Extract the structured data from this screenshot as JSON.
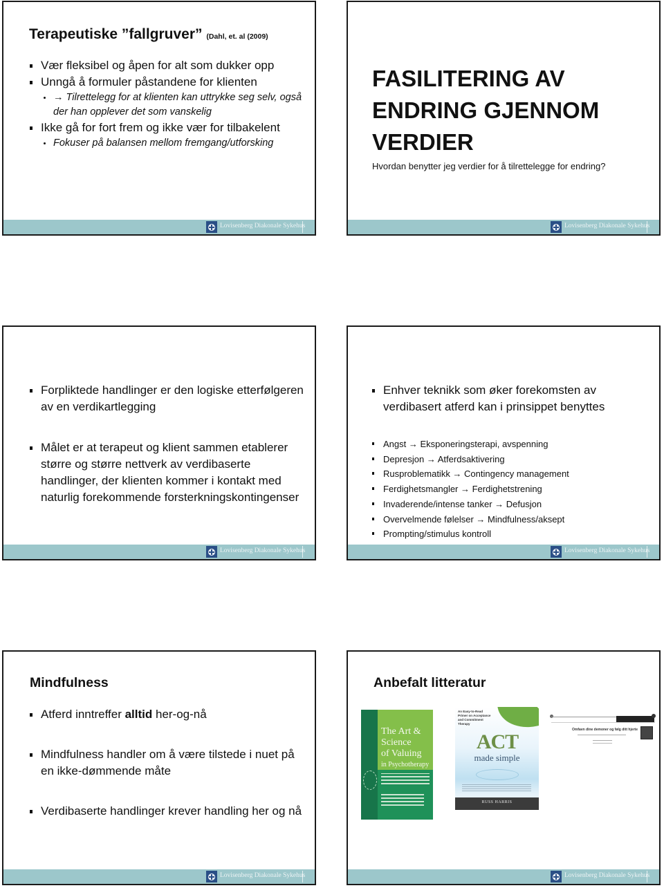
{
  "footer": {
    "org_name": "Lovisenberg Diakonale Sykehus",
    "logo_icon": "cross-circle-logo-icon",
    "band_color": "#9cc7cb"
  },
  "slides": [
    {
      "title": "Terapeutiske ”fallgruver”",
      "citation": "(Dahl, et. al (2009)",
      "bullets": [
        {
          "text": "Vær fleksibel og åpen for alt som dukker opp",
          "level": 1
        },
        {
          "text": "Unngå å formuler påstandene for klienten",
          "level": 1
        },
        {
          "text": "→ Tilrettelegg for at klienten kan uttrykke seg selv, også der han opplever det som vanskelig",
          "level": 2
        },
        {
          "text": "Ikke gå for fort frem og ikke vær for tilbakelent",
          "level": 1
        },
        {
          "text": "Fokuser på balansen mellom fremgang/utforsking",
          "level": 2
        }
      ]
    },
    {
      "title": "FASILITERING AV ENDRING GJENNOM VERDIER",
      "subtitle": "Hvordan benytter jeg verdier for å tilrettelegge for endring?"
    },
    {
      "bullets": [
        "Forpliktede handlinger er den logiske etterfølgeren av en verdikartlegging",
        "Målet er at terapeut og klient sammen etablerer større og større nettverk av verdibaserte handlinger, der klienten kommer i kontakt med naturlig forekommende forsterkningskontingenser"
      ]
    },
    {
      "main_bullet": "Enhver teknikk som øker forekomsten av verdibasert atferd kan i prinsippet benyttes",
      "items": [
        "Angst → Eksponeringsterapi, avspenning",
        "Depresjon → Atferdsaktivering",
        "Rusproblematikk → Contingency management",
        "Ferdighetsmangler → Ferdighetstrening",
        "Invaderende/intense tanker → Defusjon",
        "Overvelmende følelser → Mindfulness/aksept",
        "Prompting/stimulus kontroll"
      ]
    },
    {
      "title": "Mindfulness",
      "bullets": [
        {
          "before": "Atferd inntreffer ",
          "bold": "alltid",
          "after": " her-og-nå"
        },
        {
          "text": "Mindfulness handler om å være tilstede i nuet på en ikke-dømmende måte"
        },
        {
          "text": "Verdibaserte handlinger krever handling her og nå"
        }
      ]
    },
    {
      "title": "Anbefalt litteratur",
      "books": [
        {
          "title_line1": "The Art &",
          "title_line2": "Science",
          "title_line3": "of Valuing",
          "title_line4": "in Psychotherapy",
          "cover_color": "#84bf4a"
        },
        {
          "primer": "An Easy-to-Read Primer on Acceptance and Commitment Therapy",
          "title_main": "ACT",
          "title_sub": "made simple",
          "author": "RUSS HARRIS",
          "cover_color": "#bfe0f1"
        },
        {
          "heading": "Omfavn dine demoner og følg ditt hjerte"
        }
      ]
    }
  ]
}
